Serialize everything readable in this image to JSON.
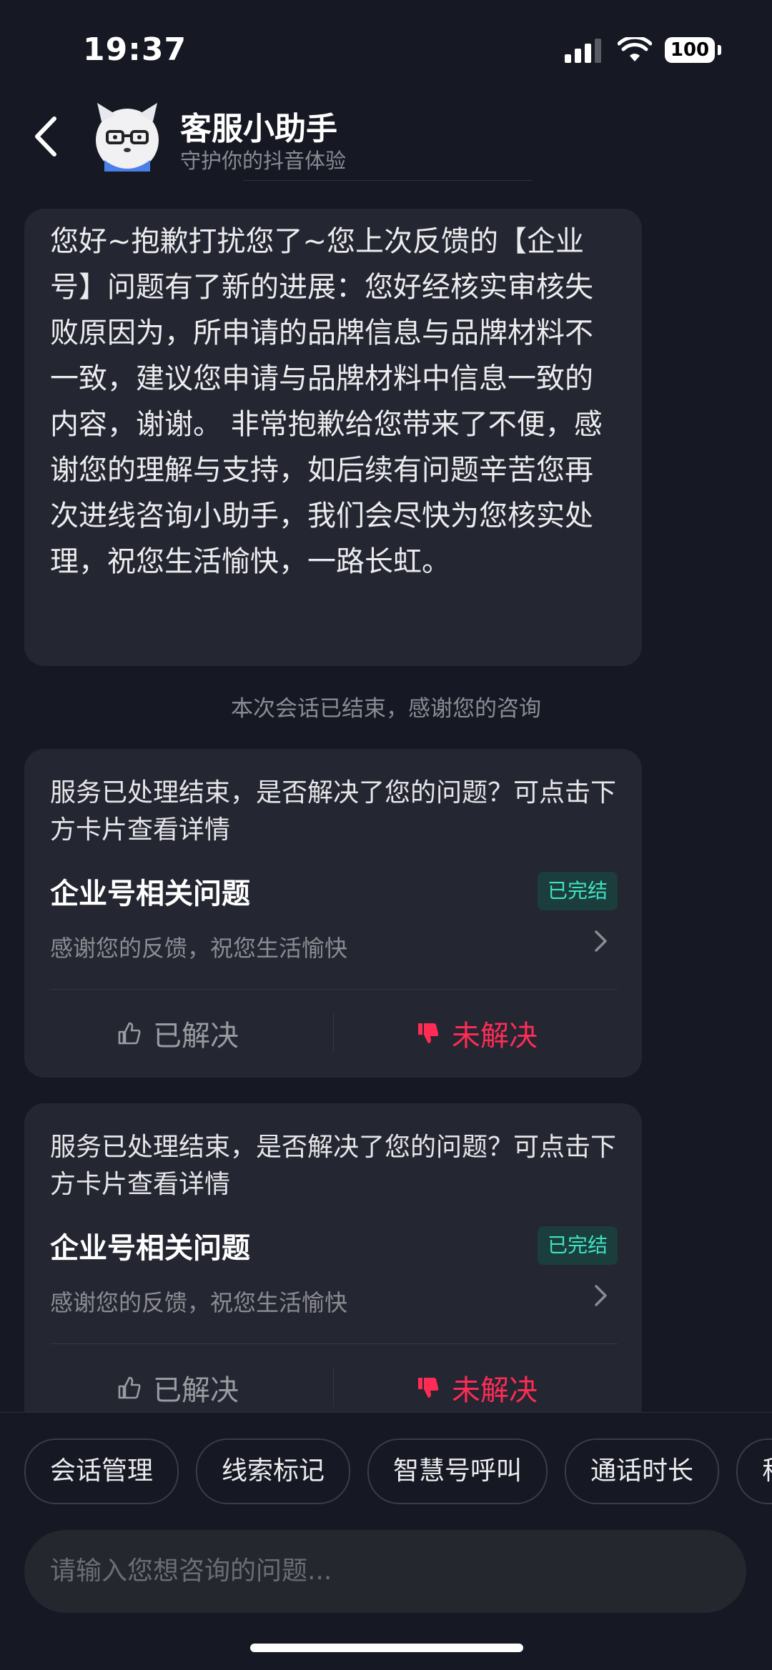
{
  "status_bar": {
    "time": "19:37",
    "battery": "100"
  },
  "header": {
    "title": "客服小助手",
    "subtitle": "守护你的抖音体验"
  },
  "message": {
    "text": "您好~抱歉打扰您了~您上次反馈的【企业号】问题有了新的进展：您好经核实审核失败原因为，所申请的品牌信息与品牌材料不一致，建议您申请与品牌材料中信息一致的内容，谢谢。 非常抱歉给您带来了不便，感谢您的理解与支持，如后续有问题辛苦您再次进线咨询小助手，我们会尽快为您核实处理，祝您生活愉快，一路长虹。"
  },
  "session_end_notice": "本次会话已结束，感谢您的咨询",
  "cards": [
    {
      "prompt": "服务已处理结束，是否解决了您的问题？可点击下方卡片查看详情",
      "topic": "企业号相关问题",
      "status": "已完结",
      "detail": "感谢您的反馈，祝您生活愉快",
      "resolved_label": "已解决",
      "unresolved_label": "未解决"
    },
    {
      "prompt": "服务已处理结束，是否解决了您的问题？可点击下方卡片查看详情",
      "topic": "企业号相关问题",
      "status": "已完结",
      "detail": "感谢您的反馈，祝您生活愉快",
      "resolved_label": "已解决",
      "unresolved_label": "未解决"
    }
  ],
  "quick_actions": [
    "会话管理",
    "线索标记",
    "智慧号呼叫",
    "通话时长",
    "称"
  ],
  "input": {
    "placeholder": "请输入您想咨询的问题..."
  },
  "colors": {
    "background": "#161823",
    "bubble": "#242631",
    "accent_red": "#fe2c55",
    "badge_text": "#3fe2c3",
    "badge_bg": "#1b3d3b"
  }
}
